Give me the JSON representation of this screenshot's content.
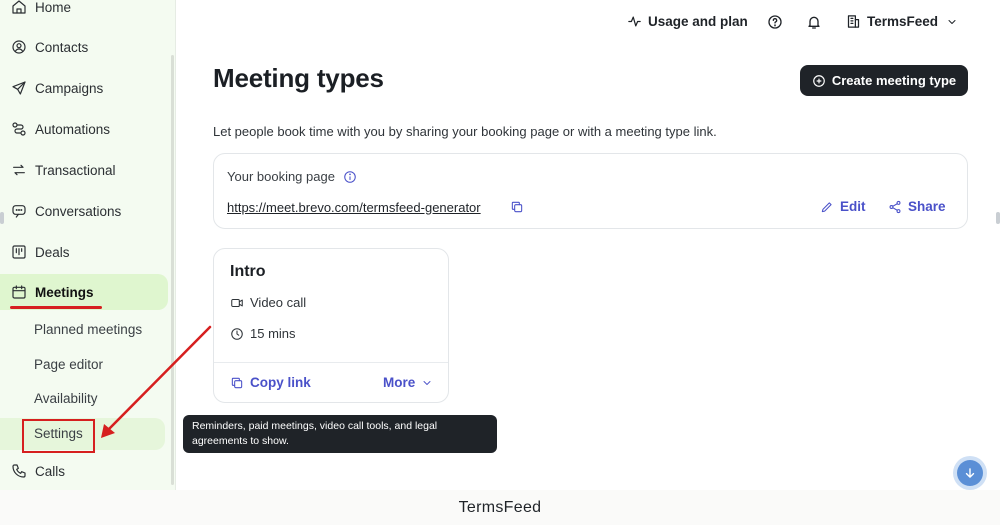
{
  "sidebar": {
    "items": [
      {
        "label": "Home",
        "icon": "home-icon"
      },
      {
        "label": "Contacts",
        "icon": "contacts-icon"
      },
      {
        "label": "Campaigns",
        "icon": "send-icon"
      },
      {
        "label": "Automations",
        "icon": "automations-icon"
      },
      {
        "label": "Transactional",
        "icon": "transfer-icon"
      },
      {
        "label": "Conversations",
        "icon": "chat-icon"
      },
      {
        "label": "Deals",
        "icon": "board-icon"
      },
      {
        "label": "Meetings",
        "icon": "calendar-icon"
      }
    ],
    "sub_items": [
      "Planned meetings",
      "Page editor",
      "Availability",
      "Settings"
    ],
    "calls_label": "Calls"
  },
  "topbar": {
    "usage_label": "Usage and plan",
    "account_label": "TermsFeed"
  },
  "main": {
    "title": "Meeting types",
    "create_button": "Create meeting type",
    "subtitle": "Let people book time with you by sharing your booking page or with a meeting type link.",
    "booking": {
      "label": "Your booking page",
      "url": "https://meet.brevo.com/termsfeed-generator",
      "edit_label": "Edit",
      "share_label": "Share"
    },
    "meeting_card": {
      "title": "Intro",
      "location": "Video call",
      "duration": "15 mins",
      "copy_link_label": "Copy link",
      "more_label": "More"
    }
  },
  "tooltip": {
    "line1": "Reminders, paid meetings, video call tools, and legal",
    "line2": "agreements to show."
  },
  "footer": {
    "caption": "TermsFeed"
  },
  "colors": {
    "accent": "#4a51c9",
    "sidebar_bg": "#f4fbf1",
    "active_bg": "#dff6cf",
    "annotation_red": "#d61f1f",
    "dark_button": "#1f2328"
  }
}
